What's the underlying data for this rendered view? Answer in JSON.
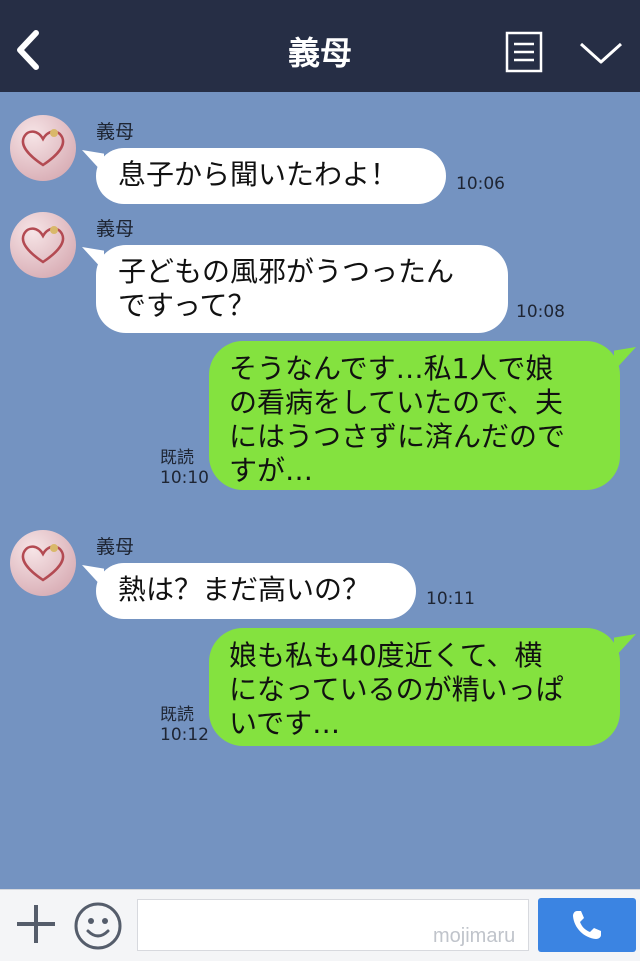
{
  "header": {
    "title": "義母",
    "icons": [
      "back-icon",
      "menu-list-icon",
      "chevron-down-icon"
    ],
    "background": "#262e45"
  },
  "chat": {
    "background": "#7493c1",
    "messages": [
      {
        "from": "義母",
        "side": "in",
        "text": "息子から聞いたわよ！",
        "time": "10:06"
      },
      {
        "from": "義母",
        "side": "in",
        "lines": [
          "子どもの風邪がうつったん",
          "ですって？"
        ],
        "time": "10:08"
      },
      {
        "side": "out",
        "lines": [
          "そうなんです…私1人で娘",
          "の看病をしていたので、夫",
          "にはうつさずに済んだので",
          "すが…"
        ],
        "read": "既読",
        "time": "10:10"
      },
      {
        "from": "義母",
        "side": "in",
        "text": "熱は？まだ高いの？",
        "time": "10:11"
      },
      {
        "side": "out",
        "lines": [
          "娘も私も40度近くて、横",
          "になっているのが精いっぱ",
          "いです…"
        ],
        "read": "既読",
        "time": "10:12"
      }
    ]
  },
  "footer": {
    "input_value": "",
    "watermark": "mojimaru",
    "icons": [
      "plus-icon",
      "smiley-icon",
      "phone-icon"
    ],
    "send_color": "#3b84e2"
  },
  "colors": {
    "outgoing_bubble": "#84e23f",
    "incoming_bubble": "#ffffff"
  }
}
